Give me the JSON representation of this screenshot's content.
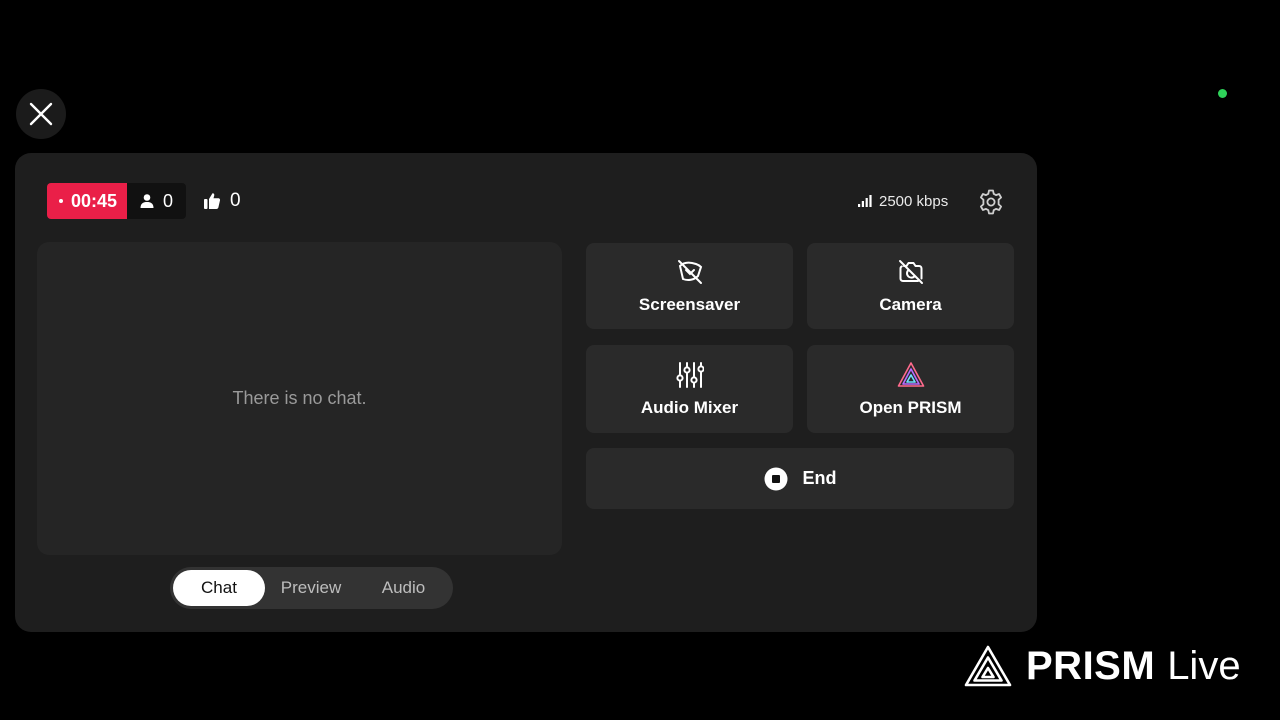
{
  "live": {
    "timer": "00:45",
    "viewers": "0",
    "likes": "0",
    "bitrate": "2500 kbps"
  },
  "chat": {
    "empty_message": "There is no chat."
  },
  "tabs": [
    {
      "label": "Chat",
      "active": true
    },
    {
      "label": "Preview",
      "active": false
    },
    {
      "label": "Audio",
      "active": false
    }
  ],
  "actions": {
    "screensaver": "Screensaver",
    "camera": "Camera",
    "audio_mixer": "Audio Mixer",
    "open_prism": "Open PRISM",
    "end": "End"
  },
  "brand": {
    "name": "PRISM",
    "suffix": "Live"
  },
  "colors": {
    "live_red": "#ea1f48",
    "status_green": "#2fd35a",
    "panel_bg": "#1e1e1e"
  },
  "icons": [
    "close-icon",
    "person-icon",
    "thumbs-up-icon",
    "signal-icon",
    "gear-icon",
    "screensaver-off-icon",
    "camera-off-icon",
    "sliders-icon",
    "prism-logo-icon",
    "stop-icon"
  ]
}
